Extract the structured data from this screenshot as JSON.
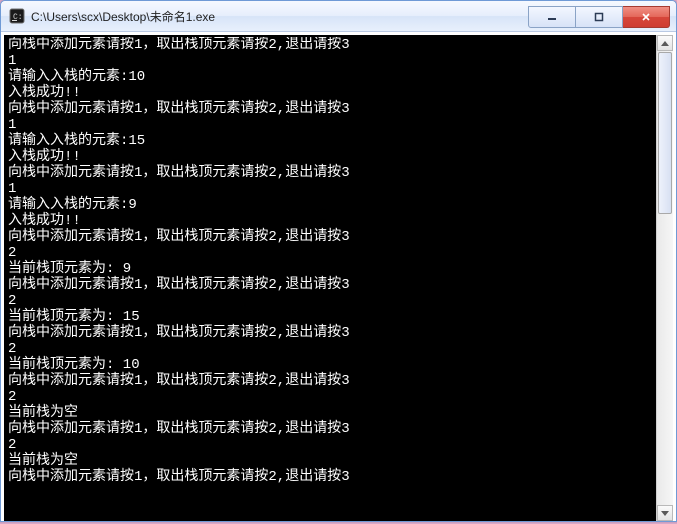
{
  "window": {
    "title": "C:\\Users\\scx\\Desktop\\未命名1.exe"
  },
  "console": {
    "lines": [
      "向栈中添加元素请按1，取出栈顶元素请按2,退出请按3",
      "1",
      "请输入入栈的元素:10",
      "入栈成功!!",
      "向栈中添加元素请按1，取出栈顶元素请按2,退出请按3",
      "1",
      "请输入入栈的元素:15",
      "入栈成功!!",
      "向栈中添加元素请按1，取出栈顶元素请按2,退出请按3",
      "1",
      "请输入入栈的元素:9",
      "入栈成功!!",
      "向栈中添加元素请按1，取出栈顶元素请按2,退出请按3",
      "2",
      "当前栈顶元素为: 9",
      "向栈中添加元素请按1，取出栈顶元素请按2,退出请按3",
      "2",
      "当前栈顶元素为: 15",
      "向栈中添加元素请按1，取出栈顶元素请按2,退出请按3",
      "2",
      "当前栈顶元素为: 10",
      "向栈中添加元素请按1，取出栈顶元素请按2,退出请按3",
      "2",
      "当前栈为空",
      "向栈中添加元素请按1，取出栈顶元素请按2,退出请按3",
      "2",
      "当前栈为空",
      "向栈中添加元素请按1，取出栈顶元素请按2,退出请按3"
    ]
  }
}
